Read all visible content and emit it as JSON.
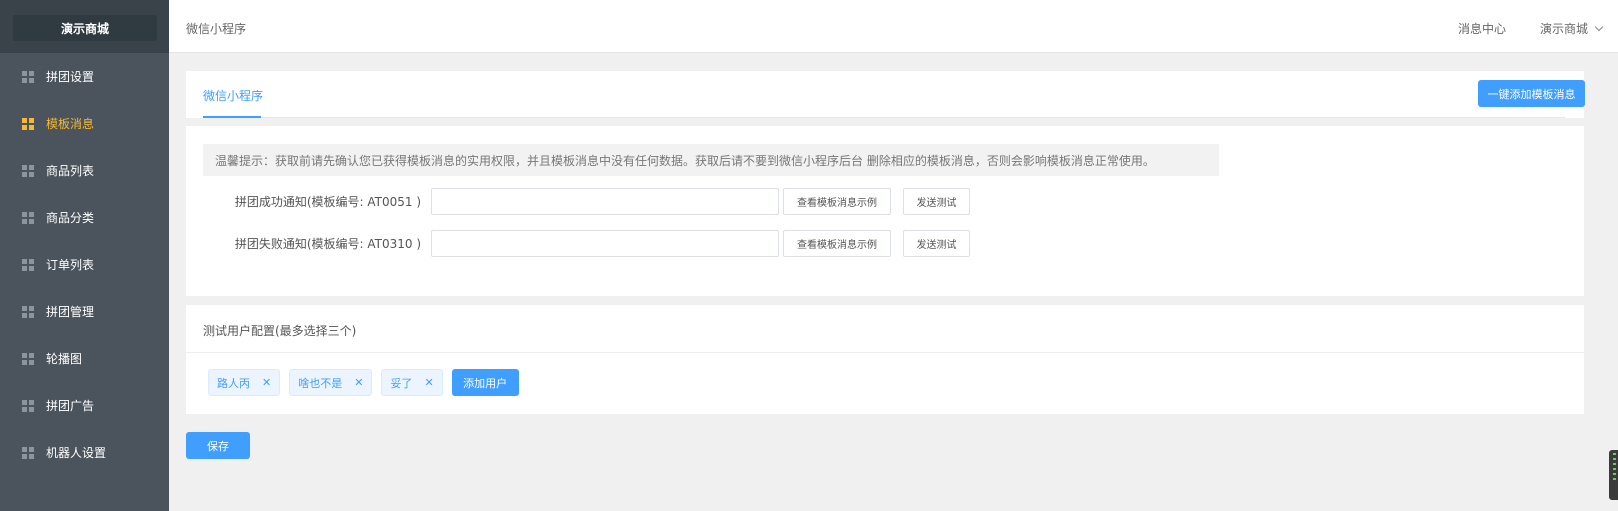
{
  "sidebar": {
    "brand": "演示商城",
    "items": [
      {
        "label": "拼团设置",
        "active": false
      },
      {
        "label": "模板消息",
        "active": true
      },
      {
        "label": "商品列表",
        "active": false
      },
      {
        "label": "商品分类",
        "active": false
      },
      {
        "label": "订单列表",
        "active": false
      },
      {
        "label": "拼团管理",
        "active": false
      },
      {
        "label": "轮播图",
        "active": false
      },
      {
        "label": "拼团广告",
        "active": false
      },
      {
        "label": "机器人设置",
        "active": false
      }
    ]
  },
  "header": {
    "breadcrumb": "微信小程序",
    "message_center": "消息中心",
    "user_menu": "演示商城"
  },
  "template_card": {
    "tab": "微信小程序",
    "add_button": "一键添加模板消息",
    "tip": "温馨提示：获取前请先确认您已获得模板消息的实用权限，并且模板消息中没有任何数据。获取后请不要到微信小程序后台 删除相应的模板消息，否则会影响模板消息正常使用。",
    "rows": [
      {
        "label": "拼团成功通知(模板编号: AT0051 )",
        "value": "",
        "view_button": "查看模板消息示例",
        "send_button": "发送测试"
      },
      {
        "label": "拼团失败通知(模板编号: AT0310 )",
        "value": "",
        "view_button": "查看模板消息示例",
        "send_button": "发送测试"
      }
    ]
  },
  "test_users": {
    "title": "测试用户配置(最多选择三个)",
    "tags": [
      "路人丙",
      "啥也不是",
      "妥了"
    ],
    "add_button": "添加用户"
  },
  "save_button": "保存",
  "colors": {
    "primary": "#409eff",
    "sidebar_bg": "#4b545c",
    "active_item": "#f7b731"
  }
}
